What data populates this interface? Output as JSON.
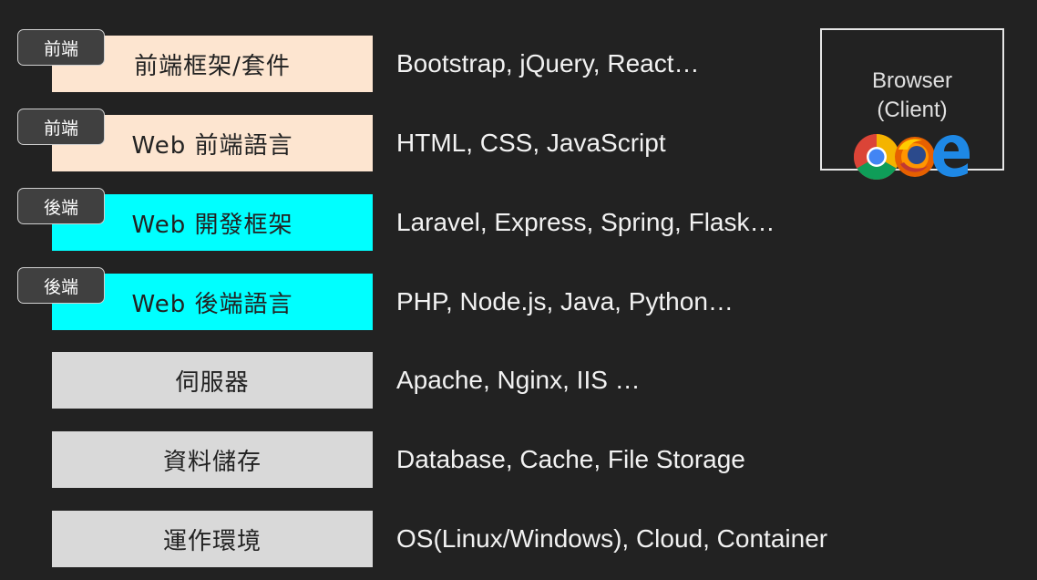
{
  "layers": [
    {
      "badge": "前端",
      "label": "前端框架/套件",
      "desc": "Bootstrap, jQuery, React…",
      "kind": "frontend"
    },
    {
      "badge": "前端",
      "label": "Web 前端語言",
      "desc": "HTML, CSS, JavaScript",
      "kind": "frontend"
    },
    {
      "badge": "後端",
      "label": "Web 開發框架",
      "desc": "Laravel, Express, Spring, Flask…",
      "kind": "backend"
    },
    {
      "badge": "後端",
      "label": "Web 後端語言",
      "desc": "PHP, Node.js, Java, Python…",
      "kind": "backend"
    },
    {
      "label": "伺服器",
      "desc": "Apache, Nginx, IIS …",
      "kind": "infra"
    },
    {
      "label": "資料儲存",
      "desc": "Database, Cache, File Storage",
      "kind": "infra"
    },
    {
      "label": "運作環境",
      "desc": "OS(Linux/Windows), Cloud, Container",
      "kind": "infra"
    }
  ],
  "browser": {
    "line1": "Browser",
    "line2": "(Client)",
    "icons": [
      "chrome-icon",
      "firefox-icon",
      "edge-icon"
    ]
  },
  "colors": {
    "background": "#222222",
    "frontend": "#fde5d0",
    "backend": "#00ffff",
    "infra": "#d9d9d9"
  }
}
